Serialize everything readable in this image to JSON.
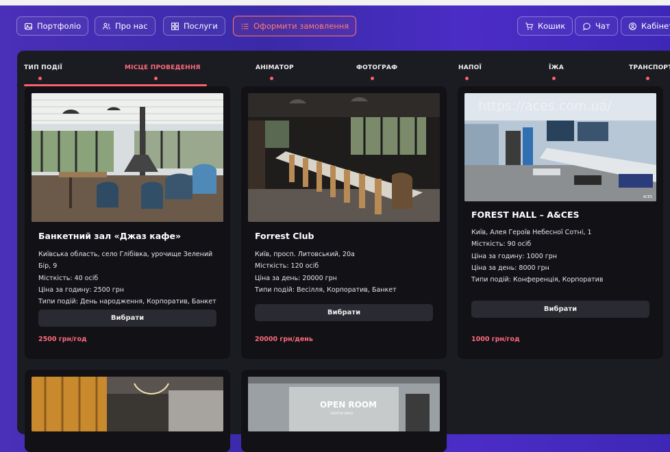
{
  "nav": {
    "portfolio": "Портфоліо",
    "about": "Про нас",
    "services": "Послуги",
    "order": "Оформити замовлення",
    "cart": "Кошик",
    "chat": "Чат",
    "cabinet": "Кабінет"
  },
  "tabs": [
    "ТИП ПОДІЇ",
    "МІСЦЕ ПРОВЕДЕННЯ",
    "АНІМАТОР",
    "ФОТОГРАФ",
    "НАПОЇ",
    "ЇЖА",
    "ТРАНСПОРТ"
  ],
  "active_tab": "МІСЦЕ ПРОВЕДЕННЯ",
  "cards": [
    {
      "title": "Банкетний зал «Джаз кафе»",
      "address": "Київська область, село Глібівка, урочище Зелений Бір, 9",
      "capacity": "Місткість: 40 осіб",
      "price_hour": "Ціна за годину: 2500 грн",
      "types": "Типи подій: День народження, Корпоратив, Банкет",
      "button": "Вибрати",
      "price": "2500 грн/год"
    },
    {
      "title": "Forrest Club",
      "address": "Київ, просп. Литовський, 20а",
      "capacity": "Місткість: 120 осіб",
      "price_day": "Ціна за день: 20000 грн",
      "types": "Типи подій: Весілля, Корпоратив, Банкет",
      "button": "Вибрати",
      "price": "20000 грн/день"
    },
    {
      "title": "FOREST HALL – A&CES",
      "address": "Київ, Алея Героїв Небесної Сотні, 1",
      "capacity": "Місткість: 90 осіб",
      "price_hour": "Ціна за годину: 1000 грн",
      "price_day": "Ціна за день: 8000 грн",
      "types": "Типи подій: Конференція, Корпоратив",
      "button": "Вибрати",
      "price": "1000 грн/год",
      "watermark": "https://aces.com.ua/",
      "photo_tag": "ACES"
    }
  ],
  "partial_cards": [
    {
      "photo_text": ""
    },
    {
      "photo_text": "OPEN ROOM",
      "photo_subtext": "CREATIVE SPACE"
    }
  ],
  "colors": {
    "accent": "#ff6b7a",
    "panel": "#1b1b22",
    "card": "#111116"
  }
}
